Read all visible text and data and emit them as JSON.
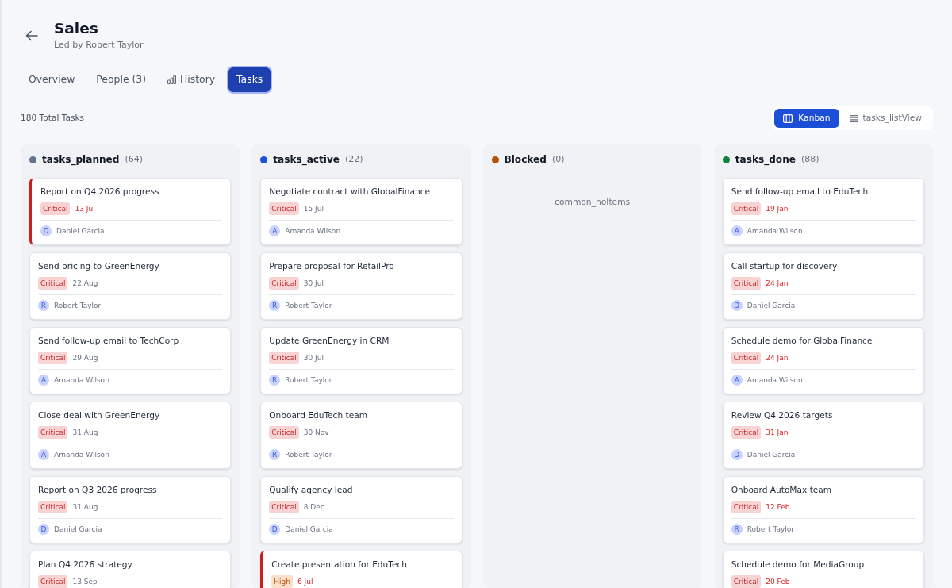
{
  "header": {
    "title": "Sales",
    "subtitle": "Led by Robert Taylor"
  },
  "tabs": [
    {
      "label": "Overview",
      "selected": false,
      "has_icon": false
    },
    {
      "label": "People (3)",
      "selected": false,
      "has_icon": false
    },
    {
      "label": "History",
      "selected": false,
      "has_icon": true
    },
    {
      "label": "Tasks",
      "selected": true,
      "has_icon": false
    }
  ],
  "summary": "180 Total Tasks",
  "view_toggle": [
    {
      "label": "Kanban",
      "kind": "kanban",
      "selected": true
    },
    {
      "label": "tasks_listView",
      "kind": "list",
      "selected": false
    }
  ],
  "columns": [
    {
      "name": "tasks_planned",
      "count": "(64)",
      "color": "#64748b",
      "cards": [
        {
          "title": "Report on Q4 2026 progress",
          "priority": {
            "label": "Critical",
            "kind": "critical"
          },
          "due": "13 Jul",
          "due_alert": true,
          "overdue": true,
          "assignee": {
            "initial": "D",
            "name": "Daniel Garcia"
          }
        },
        {
          "title": "Send pricing to GreenEnergy",
          "priority": {
            "label": "Critical",
            "kind": "critical"
          },
          "due": "22 Aug",
          "due_alert": false,
          "overdue": false,
          "assignee": {
            "initial": "R",
            "name": "Robert Taylor"
          }
        },
        {
          "title": "Send follow-up email to TechCorp",
          "priority": {
            "label": "Critical",
            "kind": "critical"
          },
          "due": "29 Aug",
          "due_alert": false,
          "overdue": false,
          "assignee": {
            "initial": "A",
            "name": "Amanda Wilson"
          }
        },
        {
          "title": "Close deal with GreenEnergy",
          "priority": {
            "label": "Critical",
            "kind": "critical"
          },
          "due": "31 Aug",
          "due_alert": false,
          "overdue": false,
          "assignee": {
            "initial": "A",
            "name": "Amanda Wilson"
          }
        },
        {
          "title": "Report on Q3 2026 progress",
          "priority": {
            "label": "Critical",
            "kind": "critical"
          },
          "due": "31 Aug",
          "due_alert": false,
          "overdue": false,
          "assignee": {
            "initial": "D",
            "name": "Daniel Garcia"
          }
        },
        {
          "title": "Plan Q4 2026 strategy",
          "priority": {
            "label": "Critical",
            "kind": "critical"
          },
          "due": "13 Sep",
          "due_alert": false,
          "overdue": false
        }
      ]
    },
    {
      "name": "tasks_active",
      "count": "(22)",
      "color": "#1d4ed8",
      "cards": [
        {
          "title": "Negotiate contract with GlobalFinance",
          "priority": {
            "label": "Critical",
            "kind": "critical"
          },
          "due": "15 Jul",
          "due_alert": false,
          "overdue": false,
          "assignee": {
            "initial": "A",
            "name": "Amanda Wilson"
          }
        },
        {
          "title": "Prepare proposal for RetailPro",
          "priority": {
            "label": "Critical",
            "kind": "critical"
          },
          "due": "30 Jul",
          "due_alert": false,
          "overdue": false,
          "assignee": {
            "initial": "R",
            "name": "Robert Taylor"
          }
        },
        {
          "title": "Update GreenEnergy in CRM",
          "priority": {
            "label": "Critical",
            "kind": "critical"
          },
          "due": "30 Jul",
          "due_alert": false,
          "overdue": false,
          "assignee": {
            "initial": "R",
            "name": "Robert Taylor"
          }
        },
        {
          "title": "Onboard EduTech team",
          "priority": {
            "label": "Critical",
            "kind": "critical"
          },
          "due": "30 Nov",
          "due_alert": false,
          "overdue": false,
          "assignee": {
            "initial": "R",
            "name": "Robert Taylor"
          }
        },
        {
          "title": "Qualify agency lead",
          "priority": {
            "label": "Critical",
            "kind": "critical"
          },
          "due": "8 Dec",
          "due_alert": false,
          "overdue": false,
          "assignee": {
            "initial": "D",
            "name": "Daniel Garcia"
          }
        },
        {
          "title": "Create presentation for EduTech",
          "priority": {
            "label": "High",
            "kind": "high"
          },
          "due": "6 Jul",
          "due_alert": true,
          "overdue": true
        }
      ]
    },
    {
      "name": "Blocked",
      "count": "(0)",
      "color": "#b45309",
      "empty_text": "common_noItems"
    },
    {
      "name": "tasks_done",
      "count": "(88)",
      "color": "#15803d",
      "cards": [
        {
          "title": "Send follow-up email to EduTech",
          "priority": {
            "label": "Critical",
            "kind": "critical"
          },
          "due": "19 Jan",
          "due_alert": true,
          "overdue": false,
          "assignee": {
            "initial": "A",
            "name": "Amanda Wilson"
          }
        },
        {
          "title": "Call startup for discovery",
          "priority": {
            "label": "Critical",
            "kind": "critical"
          },
          "due": "24 Jan",
          "due_alert": true,
          "overdue": false,
          "assignee": {
            "initial": "D",
            "name": "Daniel Garcia"
          }
        },
        {
          "title": "Schedule demo for GlobalFinance",
          "priority": {
            "label": "Critical",
            "kind": "critical"
          },
          "due": "24 Jan",
          "due_alert": true,
          "overdue": false,
          "assignee": {
            "initial": "A",
            "name": "Amanda Wilson"
          }
        },
        {
          "title": "Review Q4 2026 targets",
          "priority": {
            "label": "Critical",
            "kind": "critical"
          },
          "due": "31 Jan",
          "due_alert": true,
          "overdue": false,
          "assignee": {
            "initial": "D",
            "name": "Daniel Garcia"
          }
        },
        {
          "title": "Onboard AutoMax team",
          "priority": {
            "label": "Critical",
            "kind": "critical"
          },
          "due": "12 Feb",
          "due_alert": true,
          "overdue": false,
          "assignee": {
            "initial": "R",
            "name": "Robert Taylor"
          }
        },
        {
          "title": "Schedule demo for MediaGroup",
          "priority": {
            "label": "Critical",
            "kind": "critical"
          },
          "due": "20 Feb",
          "due_alert": true,
          "overdue": false
        }
      ]
    }
  ]
}
